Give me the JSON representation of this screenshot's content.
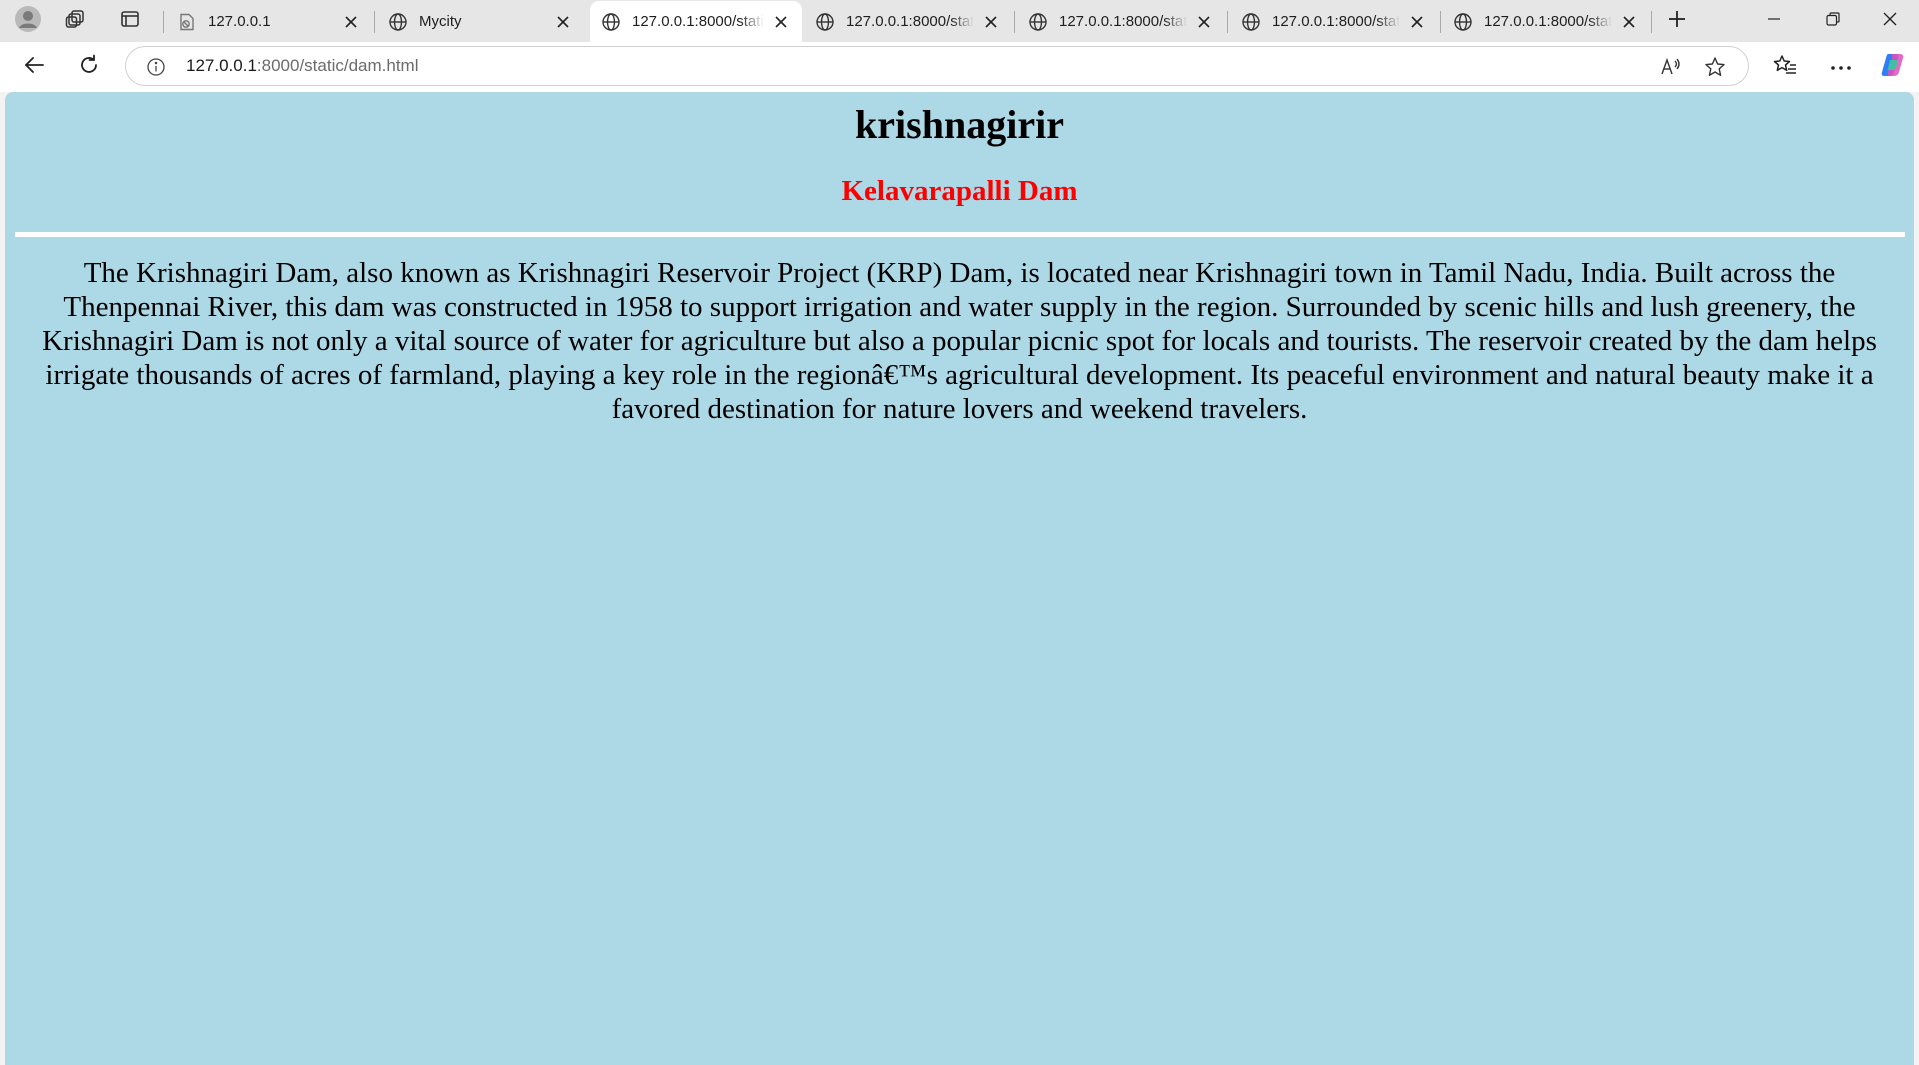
{
  "browser": {
    "tabs": [
      {
        "title": "127.0.0.1",
        "icon": "page-error-icon",
        "active": false
      },
      {
        "title": "Mycity",
        "icon": "globe-icon",
        "active": false
      },
      {
        "title": "127.0.0.1:8000/static/dam.html",
        "icon": "globe-icon",
        "active": true
      },
      {
        "title": "127.0.0.1:8000/static",
        "icon": "globe-icon",
        "active": false
      },
      {
        "title": "127.0.0.1:8000/static",
        "icon": "globe-icon",
        "active": false
      },
      {
        "title": "127.0.0.1:8000/static",
        "icon": "globe-icon",
        "active": false
      },
      {
        "title": "127.0.0.1:8000/static",
        "icon": "globe-icon",
        "active": false
      }
    ],
    "address": {
      "host": "127.0.0.1",
      "path": ":8000/static/dam.html"
    }
  },
  "page": {
    "background_color": "#add8e6",
    "title": "krishnagirir",
    "subtitle": "Kelavarapalli Dam",
    "subtitle_color": "#ff0000",
    "divider_color": "#ffffff",
    "paragraph": "The Krishnagiri Dam, also known as Krishnagiri Reservoir Project (KRP) Dam, is located near Krishnagiri town in Tamil Nadu, India. Built across the Thenpennai River, this dam was constructed in 1958 to support irrigation and water supply in the region. Surrounded by scenic hills and lush greenery, the Krishnagiri Dam is not only a vital source of water for agriculture but also a popular picnic spot for locals and tourists. The reservoir created by the dam helps irrigate thousands of acres of farmland, playing a key role in the regionâ€™s agricultural development. Its peaceful environment and natural beauty make it a favored destination for nature lovers and weekend travelers."
  }
}
